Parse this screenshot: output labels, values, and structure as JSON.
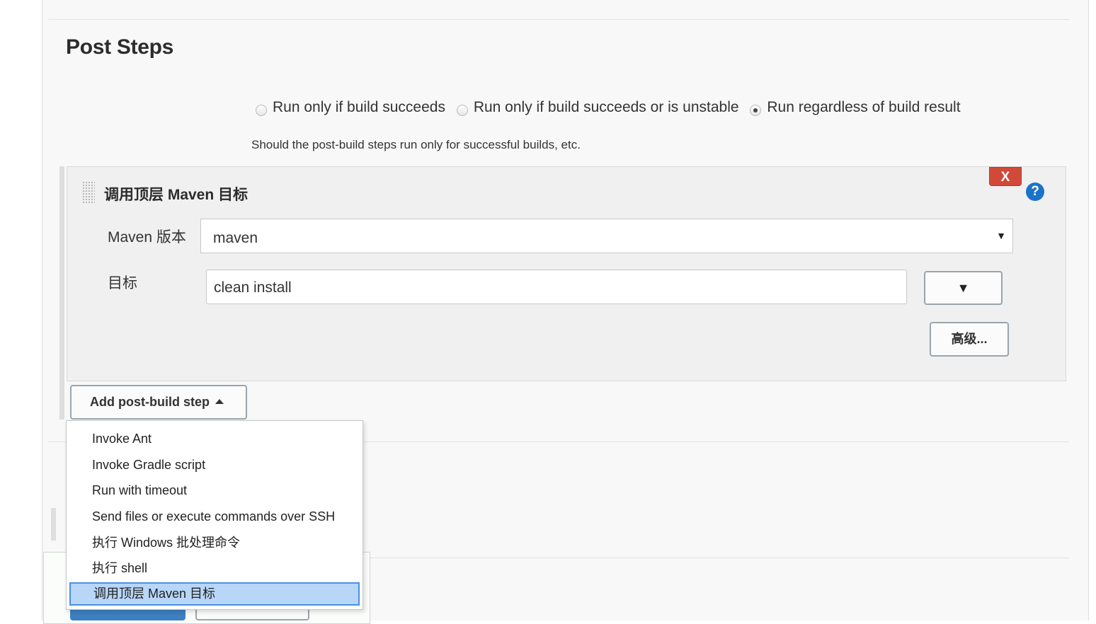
{
  "section": {
    "title": "Post Steps"
  },
  "run_conditions": {
    "options": [
      {
        "label": "Run only if build succeeds",
        "checked": false
      },
      {
        "label": "Run only if build succeeds or is unstable",
        "checked": false
      },
      {
        "label": "Run regardless of build result",
        "checked": true
      }
    ],
    "help_text": "Should the post-build steps run only for successful builds, etc."
  },
  "step": {
    "title": "调用顶层 Maven 目标",
    "delete_label": "X",
    "help_icon": "question-icon",
    "help_glyph": "?",
    "maven_version": {
      "label": "Maven 版本",
      "value": "maven",
      "arrow": "▼"
    },
    "goals": {
      "label": "目标",
      "value": "clean install",
      "expand_glyph": "▼"
    },
    "advanced_label": "高级..."
  },
  "add_step": {
    "label": "Add post-build step"
  },
  "menu": {
    "items": [
      {
        "label": "Invoke Ant"
      },
      {
        "label": "Invoke Gradle script"
      },
      {
        "label": "Run with timeout"
      },
      {
        "label": "Send files or execute commands over SSH"
      },
      {
        "label": "执行 Windows 批处理命令"
      },
      {
        "label": "执行 shell"
      },
      {
        "label": "调用顶层 Maven 目标"
      }
    ],
    "selected_index": 6
  },
  "colors": {
    "delete": "#d24939",
    "help": "#1a73c9",
    "selection": "#b7d6f8",
    "primary_button": "#3e7fc1"
  }
}
